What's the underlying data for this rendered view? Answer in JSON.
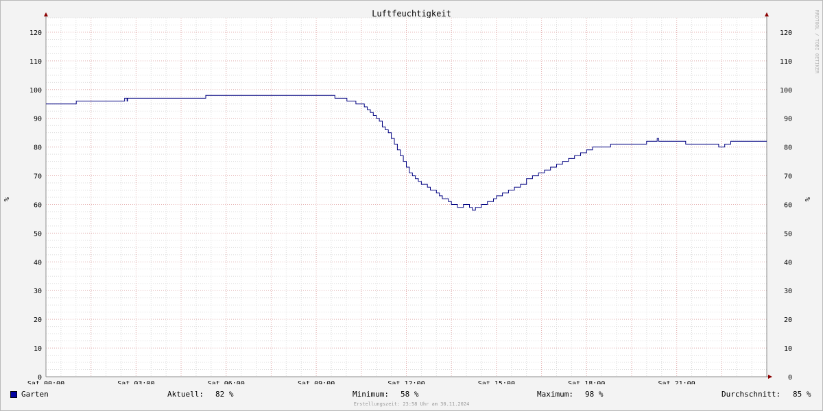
{
  "chart_data": {
    "type": "line",
    "title": "Luftfeuchtigkeit",
    "ylabel": "%",
    "xlabel": "",
    "ylim": [
      0,
      125
    ],
    "xlim_hours": [
      0,
      24
    ],
    "y_ticks": [
      0,
      10,
      20,
      30,
      40,
      50,
      60,
      70,
      80,
      90,
      100,
      110,
      120
    ],
    "x_ticks": [
      {
        "h": 0,
        "label": "Sat 00:00"
      },
      {
        "h": 3,
        "label": "Sat 03:00"
      },
      {
        "h": 6,
        "label": "Sat 06:00"
      },
      {
        "h": 9,
        "label": "Sat 09:00"
      },
      {
        "h": 12,
        "label": "Sat 12:00"
      },
      {
        "h": 15,
        "label": "Sat 15:00"
      },
      {
        "h": 18,
        "label": "Sat 18:00"
      },
      {
        "h": 21,
        "label": "Sat 21:00"
      }
    ],
    "grid": true,
    "series": [
      {
        "name": "Garten",
        "color": "#000080",
        "x_hours": [
          0,
          1,
          1.01,
          2.6,
          2.62,
          2.7,
          2.72,
          5.3,
          5.32,
          9.6,
          9.62,
          10.0,
          10.02,
          10.3,
          10.32,
          10.6,
          10.7,
          10.8,
          10.9,
          11.0,
          11.1,
          11.2,
          11.3,
          11.4,
          11.5,
          11.6,
          11.7,
          11.8,
          11.9,
          12.0,
          12.1,
          12.2,
          12.3,
          12.4,
          12.5,
          12.6,
          12.7,
          12.8,
          12.9,
          13.0,
          13.1,
          13.2,
          13.3,
          13.4,
          13.5,
          13.6,
          13.7,
          13.8,
          13.9,
          14.0,
          14.1,
          14.2,
          14.3,
          14.4,
          14.5,
          14.6,
          14.7,
          14.8,
          14.9,
          15.0,
          15.1,
          15.2,
          15.3,
          15.4,
          15.5,
          15.6,
          15.8,
          16.0,
          16.2,
          16.4,
          16.6,
          16.8,
          17.0,
          17.2,
          17.4,
          17.6,
          17.8,
          18.0,
          18.2,
          18.5,
          18.8,
          19.2,
          19.6,
          20.0,
          20.3,
          20.35,
          20.4,
          20.9,
          21.3,
          21.4,
          22.4,
          22.6,
          22.8,
          24.0
        ],
        "values": [
          95,
          95,
          96,
          96,
          97,
          96,
          97,
          97,
          98,
          98,
          97,
          97,
          96,
          96,
          95,
          94,
          93,
          92,
          91,
          90,
          89,
          87,
          86,
          85,
          83,
          81,
          79,
          77,
          75,
          73,
          71,
          70,
          69,
          68,
          67,
          67,
          66,
          65,
          65,
          64,
          63,
          62,
          62,
          61,
          60,
          60,
          59,
          59,
          60,
          60,
          59,
          58,
          59,
          59,
          60,
          60,
          61,
          61,
          62,
          63,
          63,
          64,
          64,
          65,
          65,
          66,
          67,
          69,
          70,
          71,
          72,
          73,
          74,
          75,
          76,
          77,
          78,
          79,
          80,
          80,
          81,
          81,
          81,
          82,
          82,
          83,
          82,
          82,
          81,
          81,
          80,
          81,
          82,
          82
        ]
      }
    ]
  },
  "legend": {
    "series_name": "Garten",
    "swatch_color": "#0000a0",
    "current_label": "Aktuell:",
    "current_value": "82 %",
    "min_label": "Minimum:",
    "min_value": "58 %",
    "max_label": "Maximum:",
    "max_value": "98 %",
    "avg_label": "Durchschnitt:",
    "avg_value": "85 %"
  },
  "footer": "Erstellungszeit: 23:58 Uhr am 30.11.2024",
  "watermark": "RRDTOOL / TOBI OETIKER"
}
